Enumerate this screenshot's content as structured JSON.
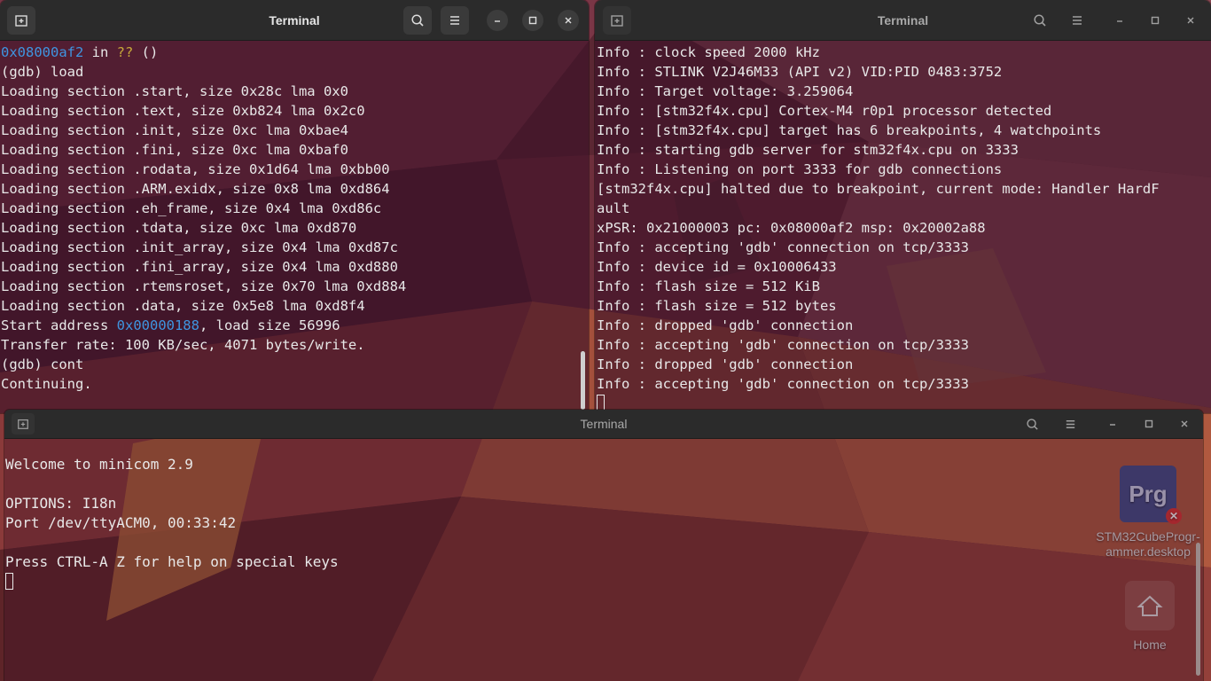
{
  "windows": {
    "gdb": {
      "title": "Terminal",
      "lines": [
        [
          {
            "t": "0x08000af2",
            "c": "addr"
          },
          {
            "t": " in "
          },
          {
            "t": "??",
            "c": "q"
          },
          {
            "t": " ()"
          }
        ],
        [
          {
            "t": "(gdb) load"
          }
        ],
        [
          {
            "t": "Loading section .start, size 0x28c lma 0x0"
          }
        ],
        [
          {
            "t": "Loading section .text, size 0xb824 lma 0x2c0"
          }
        ],
        [
          {
            "t": "Loading section .init, size 0xc lma 0xbae4"
          }
        ],
        [
          {
            "t": "Loading section .fini, size 0xc lma 0xbaf0"
          }
        ],
        [
          {
            "t": "Loading section .rodata, size 0x1d64 lma 0xbb00"
          }
        ],
        [
          {
            "t": "Loading section .ARM.exidx, size 0x8 lma 0xd864"
          }
        ],
        [
          {
            "t": "Loading section .eh_frame, size 0x4 lma 0xd86c"
          }
        ],
        [
          {
            "t": "Loading section .tdata, size 0xc lma 0xd870"
          }
        ],
        [
          {
            "t": "Loading section .init_array, size 0x4 lma 0xd87c"
          }
        ],
        [
          {
            "t": "Loading section .fini_array, size 0x4 lma 0xd880"
          }
        ],
        [
          {
            "t": "Loading section .rtemsroset, size 0x70 lma 0xd884"
          }
        ],
        [
          {
            "t": "Loading section .data, size 0x5e8 lma 0xd8f4"
          }
        ],
        [
          {
            "t": "Start address "
          },
          {
            "t": "0x00000188",
            "c": "addr"
          },
          {
            "t": ", load size 56996"
          }
        ],
        [
          {
            "t": "Transfer rate: 100 KB/sec, 4071 bytes/write."
          }
        ],
        [
          {
            "t": "(gdb) cont"
          }
        ],
        [
          {
            "t": "Continuing."
          }
        ]
      ]
    },
    "openocd": {
      "title": "Terminal",
      "lines": [
        "Info : clock speed 2000 kHz",
        "Info : STLINK V2J46M33 (API v2) VID:PID 0483:3752",
        "Info : Target voltage: 3.259064",
        "Info : [stm32f4x.cpu] Cortex-M4 r0p1 processor detected",
        "Info : [stm32f4x.cpu] target has 6 breakpoints, 4 watchpoints",
        "Info : starting gdb server for stm32f4x.cpu on 3333",
        "Info : Listening on port 3333 for gdb connections",
        "[stm32f4x.cpu] halted due to breakpoint, current mode: Handler HardF",
        "ault",
        "xPSR: 0x21000003 pc: 0x08000af2 msp: 0x20002a88",
        "Info : accepting 'gdb' connection on tcp/3333",
        "Info : device id = 0x10006433",
        "Info : flash size = 512 KiB",
        "Info : flash size = 512 bytes",
        "Info : dropped 'gdb' connection",
        "Info : accepting 'gdb' connection on tcp/3333",
        "Info : dropped 'gdb' connection",
        "Info : accepting 'gdb' connection on tcp/3333"
      ]
    },
    "minicom": {
      "title": "Terminal",
      "lines": [
        "",
        "Welcome to minicom 2.9",
        "",
        "OPTIONS: I18n",
        "Port /dev/ttyACM0, 00:33:42",
        "",
        "Press CTRL-A Z for help on special keys",
        ""
      ]
    }
  },
  "header_icons": {
    "new_tab": "new-tab-icon",
    "search": "search-icon",
    "menu": "hamburger-menu-icon",
    "minimize": "minimize-icon",
    "maximize": "maximize-icon",
    "close": "close-icon"
  },
  "desktop": {
    "icons": [
      {
        "label": "STM32CubeProgr-\nammer.desktop",
        "glyph": "Prg"
      },
      {
        "label": "Home"
      }
    ]
  },
  "colors": {
    "address": "#3f95e0",
    "unknown_symbol": "#c6a83a",
    "headerbar": "#2b2b2b",
    "terminal_text": "#e8e8e8"
  }
}
